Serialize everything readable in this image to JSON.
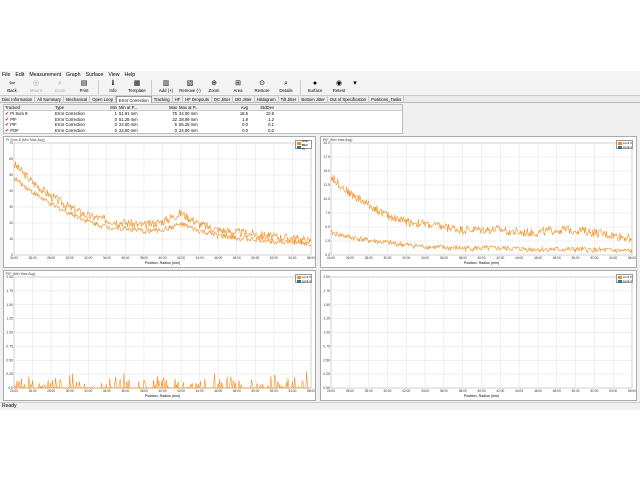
{
  "menu": [
    "File",
    "Edit",
    "Measurement",
    "Graph",
    "Surface",
    "View",
    "Help"
  ],
  "toolbar": [
    {
      "label": "Back",
      "icon": "back-arrow-icon",
      "glyph": "⇦",
      "enabled": true
    },
    {
      "label": "Mount",
      "icon": "mount-icon",
      "glyph": "◎",
      "enabled": false
    },
    {
      "label": "Zoom",
      "icon": "zoom-icon",
      "glyph": "⌕",
      "enabled": false
    },
    {
      "label": "Print",
      "icon": "print-icon",
      "glyph": "▤",
      "enabled": true
    },
    {
      "label": "Info",
      "icon": "info-icon",
      "glyph": "ℹ",
      "enabled": true
    },
    {
      "label": "Template",
      "icon": "template-icon",
      "glyph": "▦",
      "enabled": true
    },
    {
      "label": "Add (+)",
      "icon": "add-graph-icon",
      "glyph": "▥",
      "enabled": true
    },
    {
      "label": "Remove (-)",
      "icon": "remove-graph-icon",
      "glyph": "▧",
      "enabled": true
    },
    {
      "label": "Zoom",
      "icon": "zoom-in-icon",
      "glyph": "⊕",
      "enabled": true
    },
    {
      "label": "Area",
      "icon": "area-zoom-icon",
      "glyph": "⊞",
      "enabled": true
    },
    {
      "label": "Restore",
      "icon": "restore-icon",
      "glyph": "⊙",
      "enabled": true
    },
    {
      "label": "Details",
      "icon": "details-icon",
      "glyph": "⌕",
      "enabled": true
    },
    {
      "label": "Surface",
      "icon": "surface-icon",
      "glyph": "●",
      "enabled": true
    },
    {
      "label": "Retest",
      "icon": "retest-icon",
      "glyph": "◉",
      "enabled": true
    }
  ],
  "tabs": [
    "Disc Information",
    "All Summary",
    "Mechanical",
    "Open Loop",
    "Error Correction",
    "Tracking",
    "HF",
    "HF Dropouts",
    "DC Jitter",
    "DD Jitter",
    "Histogram",
    "Tilt Jitter",
    "Bottom Jitter",
    "Out of Specification",
    "Positions_Tasks"
  ],
  "active_tab": "Error Correction",
  "table": {
    "headers": [
      "Tracked",
      "Type",
      "Min",
      "Min at P...",
      "Max",
      "Max at P...",
      "Avg",
      "StdDev"
    ],
    "rows": [
      [
        "PI Sum 8",
        "Error Correction",
        "1",
        "51.91 mm",
        "75",
        "24.00 mm",
        "18.5",
        "10.9"
      ],
      [
        "PIF",
        "Error Correction",
        "0",
        "51.28 mm",
        "22",
        "28.99 mm",
        "1.9",
        "1.2"
      ],
      [
        "PIF",
        "Error Correction",
        "0",
        "24.00 mm",
        "5",
        "55.25 mm",
        "0.0",
        "0.1"
      ],
      [
        "POF",
        "Error Correction",
        "0",
        "24.00 mm",
        "0",
        "24.00 mm",
        "0.0",
        "0.0"
      ]
    ]
  },
  "colors": {
    "series1": "#f28c1c",
    "series2": "#2a7a96",
    "grid": "#d9d9d9"
  },
  "status": "Ready",
  "chart_data": [
    {
      "type": "line",
      "title": "PI Sum 8 (Min Max Avg)",
      "xlabel": "Position, Radius (mm)",
      "ylabel": "",
      "ylim": [
        0,
        80
      ],
      "yticks": [
        "0",
        "10",
        "20",
        "30",
        "40",
        "50",
        "60",
        "70"
      ],
      "x": [
        24,
        26,
        28,
        30,
        32,
        34,
        36,
        38,
        40,
        42,
        44,
        46,
        48,
        50,
        52,
        54,
        56
      ],
      "xticks": [
        "24:00",
        "26:00",
        "28:00",
        "30:00",
        "32:00",
        "34:00",
        "36:00",
        "38:00",
        "40:00",
        "42:00",
        "44:00",
        "46:00",
        "48:00",
        "50:00",
        "52:00",
        "54:00",
        "56:00"
      ],
      "series": [
        {
          "name": "Limit 75",
          "values": [
            65,
            52,
            42,
            34,
            28,
            25,
            23,
            21,
            24,
            30,
            22,
            18,
            16,
            15,
            13,
            12,
            10
          ]
        },
        {
          "name": "Limit 75",
          "values": [
            55,
            45,
            36,
            30,
            24,
            20,
            19,
            17,
            18,
            22,
            17,
            14,
            12,
            11,
            10,
            9,
            8
          ]
        }
      ],
      "legend": [
        "Limit 75",
        "Limit 75"
      ]
    },
    {
      "type": "line",
      "title": "PIF (Min Max Avg)",
      "xlabel": "Position, Radius (mm)",
      "ylabel": "",
      "ylim": [
        0,
        20
      ],
      "yticks": [
        "0.0",
        "2.5",
        "5.0",
        "7.5",
        "10.0",
        "12.5",
        "15.0",
        "17.5",
        "20.0"
      ],
      "x": [
        24,
        26,
        28,
        30,
        32,
        34,
        36,
        38,
        40,
        42,
        44,
        46,
        48,
        50,
        52,
        54,
        56
      ],
      "xticks": [
        "24:00",
        "26:00",
        "28:00",
        "30:00",
        "32:00",
        "34:00",
        "36:00",
        "38:00",
        "40:00",
        "42:00",
        "44:00",
        "46:00",
        "48:00",
        "50:00",
        "52:00",
        "54:00",
        "56:00"
      ],
      "series": [
        {
          "name": "Limit 5",
          "values": [
            14,
            11,
            9,
            7,
            6,
            5.5,
            5,
            4.5,
            4.5,
            4.5,
            4,
            4,
            4.5,
            4.5,
            4,
            3.5,
            3
          ]
        },
        {
          "name": "Limit 4",
          "values": [
            4,
            3.2,
            2.6,
            2.2,
            1.8,
            1.5,
            1.3,
            1.2,
            1.2,
            1.2,
            1.1,
            1,
            1,
            1,
            0.9,
            0.8,
            0.7
          ]
        }
      ],
      "legend": [
        "Limit 5",
        "Limit 4"
      ]
    },
    {
      "type": "line",
      "title": "PIF (Min Max Avg)",
      "xlabel": "Position, Radius (mm)",
      "ylabel": "",
      "ylim": [
        0,
        2
      ],
      "yticks": [
        "0.0",
        "0.25",
        "0.50",
        "0.75",
        "1.00",
        "1.25",
        "1.50",
        "1.75",
        "2.00"
      ],
      "x": [
        24,
        26,
        28,
        30,
        32,
        34,
        36,
        38,
        40,
        42,
        44,
        46,
        48,
        50,
        52,
        54,
        56
      ],
      "xticks": [
        "24:00",
        "26:00",
        "28:00",
        "30:00",
        "32:00",
        "34:00",
        "36:00",
        "38:00",
        "40:00",
        "42:00",
        "44:00",
        "46:00",
        "48:00",
        "50:00",
        "52:00",
        "54:00",
        "56:00"
      ],
      "series": [
        {
          "name": "Limit 5",
          "values": [
            0.1,
            0.15,
            0.1,
            0.2,
            0.1,
            0.1,
            0.25,
            0.1,
            0.15,
            0.1,
            0.1,
            0.2,
            0.1,
            0.1,
            0.15,
            0.1,
            0.45
          ]
        },
        {
          "name": "Limit 4",
          "values": [
            0,
            0,
            0,
            0,
            0,
            0,
            0,
            0,
            0,
            0,
            0,
            0,
            0,
            0,
            0,
            0,
            0
          ]
        }
      ],
      "legend": [
        "Limit 5",
        "Limit 4"
      ]
    },
    {
      "type": "line",
      "title": "",
      "xlabel": "Position, Radius (mm)",
      "ylabel": "",
      "ylim": [
        0,
        2
      ],
      "yticks": [
        "0.00",
        "0.25",
        "0.50",
        "0.75",
        "1.00",
        "1.25",
        "1.50",
        "1.75",
        "2.00"
      ],
      "x": [
        24,
        26,
        28,
        30,
        32,
        34,
        36,
        38,
        40,
        42,
        44,
        46,
        48,
        50,
        52,
        54,
        56
      ],
      "xticks": [
        "24:00",
        "26:00",
        "28:00",
        "30:00",
        "32:00",
        "34:00",
        "36:00",
        "38:00",
        "40:00",
        "42:00",
        "44:00",
        "46:00",
        "48:00",
        "50:00",
        "52:00",
        "54:00",
        "56:00"
      ],
      "series": [],
      "legend": [
        "Limit 5",
        "Limit 4"
      ]
    }
  ]
}
